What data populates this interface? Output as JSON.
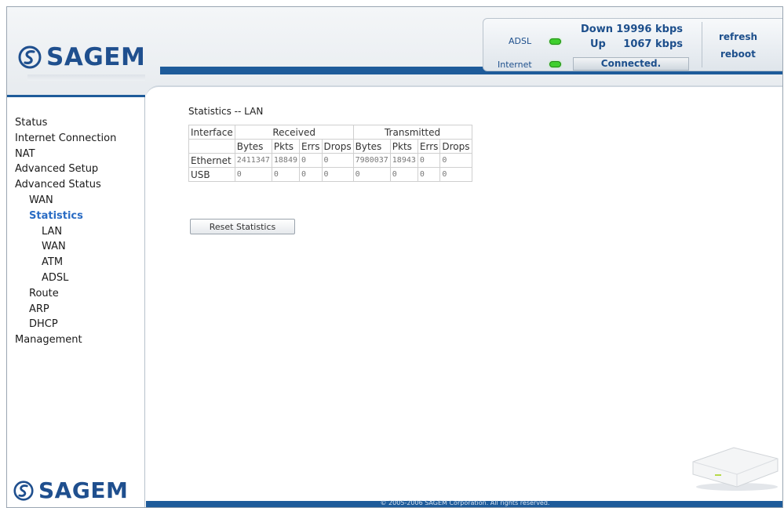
{
  "brand": {
    "name": "SAGEM"
  },
  "status": {
    "adsl_label": "ADSL",
    "internet_label": "Internet",
    "down_label": "Down",
    "down_value": "19996 kbps",
    "up_label": "Up",
    "up_value": "1067 kbps",
    "connection_text": "Connected.",
    "led_color": "#3fcf2e"
  },
  "actions": {
    "refresh": "refresh",
    "reboot": "reboot"
  },
  "nav": [
    {
      "label": "Status",
      "level": 0
    },
    {
      "label": "Internet Connection",
      "level": 0
    },
    {
      "label": "NAT",
      "level": 0
    },
    {
      "label": "Advanced Setup",
      "level": 0
    },
    {
      "label": "Advanced Status",
      "level": 0
    },
    {
      "label": "WAN",
      "level": 1
    },
    {
      "label": "Statistics",
      "level": 1,
      "active": true
    },
    {
      "label": "LAN",
      "level": 2
    },
    {
      "label": "WAN",
      "level": 2
    },
    {
      "label": "ATM",
      "level": 2
    },
    {
      "label": "ADSL",
      "level": 2
    },
    {
      "label": "Route",
      "level": 1
    },
    {
      "label": "ARP",
      "level": 1
    },
    {
      "label": "DHCP",
      "level": 1
    },
    {
      "label": "Management",
      "level": 0
    }
  ],
  "page": {
    "title": "Statistics -- LAN",
    "table": {
      "interface_header": "Interface",
      "received_header": "Received",
      "transmitted_header": "Transmitted",
      "sub_headers": [
        "Bytes",
        "Pkts",
        "Errs",
        "Drops",
        "Bytes",
        "Pkts",
        "Errs",
        "Drops"
      ],
      "rows": [
        {
          "interface": "Ethernet",
          "values": [
            "2411347",
            "18849",
            "0",
            "0",
            "7980037",
            "18943",
            "0",
            "0"
          ]
        },
        {
          "interface": "USB",
          "values": [
            "0",
            "0",
            "0",
            "0",
            "0",
            "0",
            "0",
            "0"
          ]
        }
      ]
    },
    "reset_button": "Reset Statistics"
  },
  "footer": {
    "copyright": "© 2005-2006 SAGEM Corporation. All rights reserved."
  },
  "colors": {
    "brand_blue": "#1f4f8e",
    "band_blue": "#1e5b9a",
    "active_nav": "#2a6cc4"
  }
}
